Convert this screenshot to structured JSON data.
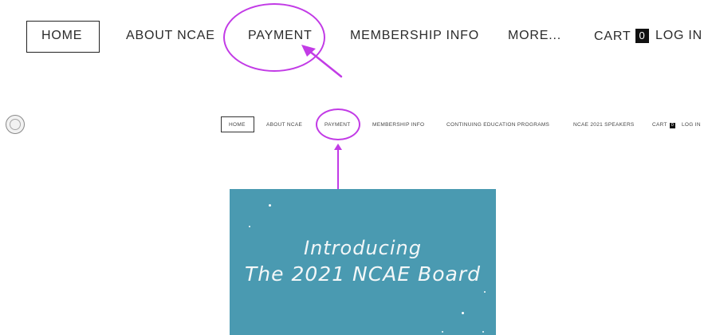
{
  "zoomed_nav": {
    "home": "HOME",
    "about": "ABOUT NCAE",
    "payment": "PAYMENT",
    "membership": "MEMBERSHIP INFO",
    "more": "MORE...",
    "cart": "CART",
    "cart_count": "0",
    "login": "LOG IN"
  },
  "site_nav": {
    "home": "HOME",
    "about": "ABOUT NCAE",
    "payment": "PAYMENT",
    "membership": "MEMBERSHIP INFO",
    "continuing_ed": "CONTINUING EDUCATION PROGRAMS",
    "speakers": "NCAE 2021 SPEAKERS",
    "cart": "CART",
    "cart_count": "0",
    "login": "LOG IN"
  },
  "banner": {
    "line1": "Introducing",
    "line2": "The 2021 NCAE Board"
  },
  "colors": {
    "annotation": "#c23be6",
    "banner_bg": "#4a9ab1"
  },
  "icons": {
    "logo": "seal-logo-icon",
    "annotation_arrow": "arrow-icon"
  }
}
